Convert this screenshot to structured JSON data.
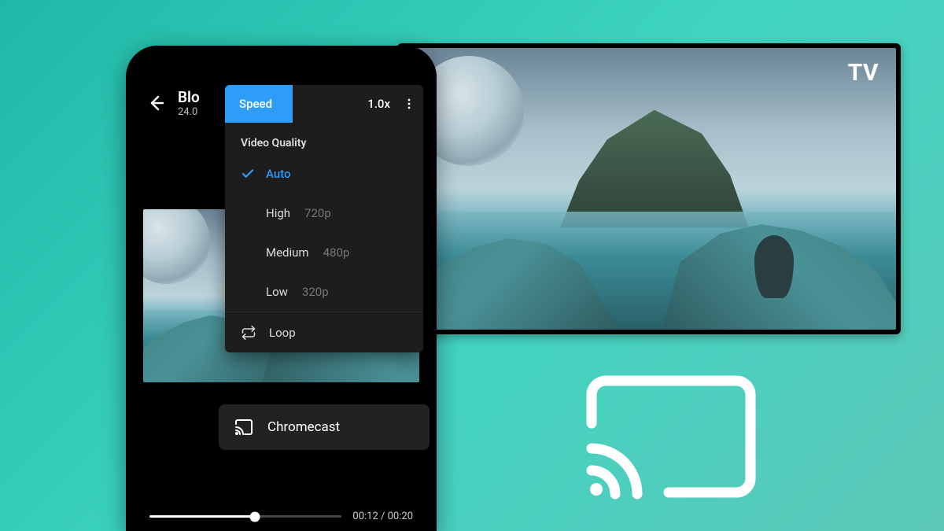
{
  "tv": {
    "label": "TV"
  },
  "header": {
    "title": "Blo",
    "subtitle": "24.0"
  },
  "menu": {
    "speed_label": "Speed",
    "speed_value": "1.0x",
    "video_quality_label": "Video Quality",
    "options": [
      {
        "label": "Auto",
        "sub": "",
        "selected": true
      },
      {
        "label": "High",
        "sub": "720p",
        "selected": false
      },
      {
        "label": "Medium",
        "sub": "480p",
        "selected": false
      },
      {
        "label": "Low",
        "sub": "320p",
        "selected": false
      }
    ],
    "loop_label": "Loop",
    "chromecast_label": "Chromecast"
  },
  "player": {
    "current": "00:12",
    "total": "00:20",
    "sep": " / "
  },
  "colors": {
    "accent": "#2e9df7"
  }
}
